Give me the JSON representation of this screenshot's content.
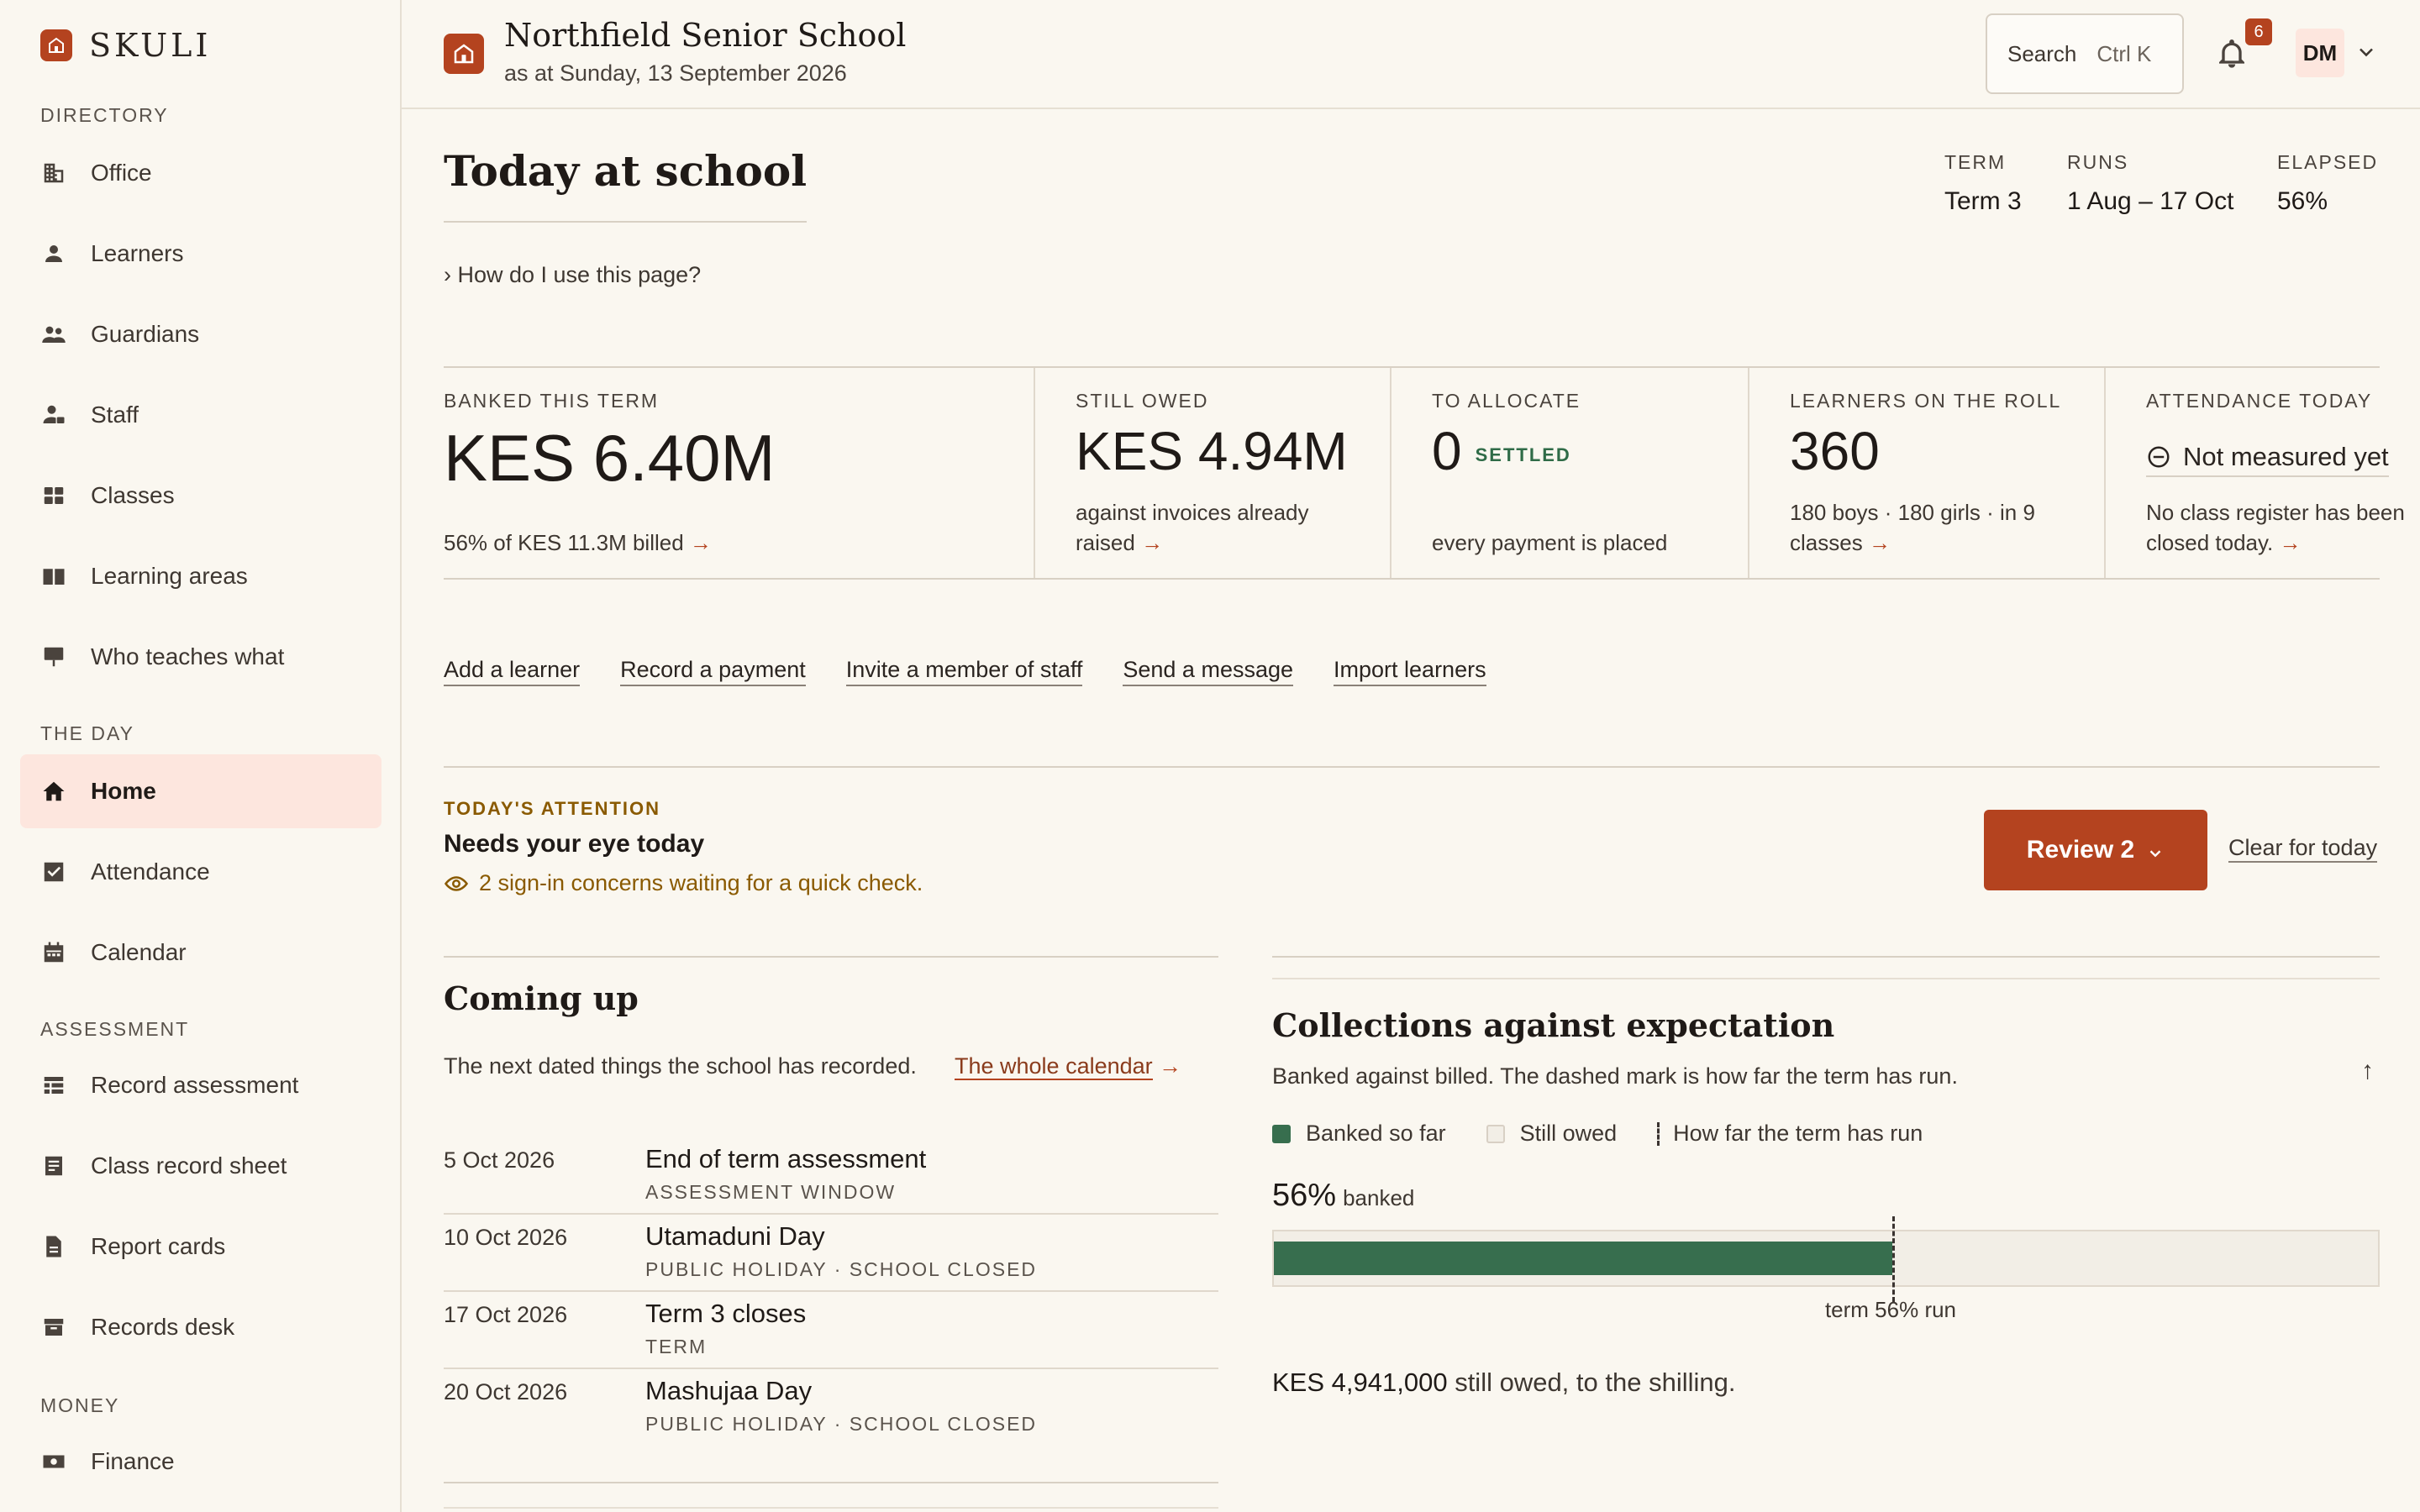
{
  "brand": {
    "name": "SKULI"
  },
  "sidebar": {
    "sections": [
      {
        "title": "Directory",
        "items": [
          "Office",
          "Learners",
          "Guardians",
          "Staff",
          "Classes",
          "Learning areas",
          "Who teaches what"
        ]
      },
      {
        "title": "The day",
        "items": [
          "Home",
          "Attendance",
          "Calendar"
        ]
      },
      {
        "title": "Assessment",
        "items": [
          "Record assessment",
          "Class record sheet",
          "Report cards",
          "Records desk"
        ]
      },
      {
        "title": "Money",
        "items": [
          "Finance"
        ]
      }
    ],
    "active": "Home"
  },
  "header": {
    "school_name": "Northfield Senior School",
    "as_at": "as at Sunday, 13 September 2026",
    "search_label": "Search",
    "search_shortcut": "Ctrl K",
    "notifications": "6",
    "avatar_initials": "DM"
  },
  "page": {
    "title": "Today at school",
    "help": "› How do I use this page?",
    "term": {
      "term_label": "Term",
      "term_value": "Term 3",
      "runs_label": "Runs",
      "runs_value": "1 Aug – 17 Oct",
      "elapsed_label": "Elapsed",
      "elapsed_value": "56%"
    }
  },
  "stats": {
    "banked": {
      "label": "Banked this term",
      "value": "KES 6.40M",
      "sub": "56% of KES 11.3M billed"
    },
    "owed": {
      "label": "Still owed",
      "value": "KES 4.94M",
      "sub1": "against invoices already",
      "sub2": "raised"
    },
    "allocate": {
      "label": "To allocate",
      "value": "0",
      "badge": "SETTLED",
      "sub": "every payment is placed"
    },
    "roll": {
      "label": "Learners on the roll",
      "value": "360",
      "sub1": "180 boys · 180 girls · in 9",
      "sub2": "classes"
    },
    "attendance": {
      "label": "Attendance today",
      "value": "Not measured yet",
      "sub1": "No class register has been",
      "sub2": "closed today."
    }
  },
  "quick_actions": [
    "Add a learner",
    "Record a payment",
    "Invite a member of staff",
    "Send a message",
    "Import learners"
  ],
  "attention": {
    "eyebrow": "TODAY'S ATTENTION",
    "title": "Needs your eye today",
    "note": "2 sign-in concerns waiting for a quick check.",
    "review_label": "Review 2",
    "clear_label": "Clear for today"
  },
  "coming_up": {
    "title": "Coming up",
    "description": "The next dated things the school has recorded.",
    "link": "The whole calendar",
    "events": [
      {
        "date": "5 Oct 2026",
        "name": "End of term assessment",
        "kind": "Assessment window"
      },
      {
        "date": "10 Oct 2026",
        "name": "Utamaduni Day",
        "kind": "Public holiday · School closed"
      },
      {
        "date": "17 Oct 2026",
        "name": "Term 3 closes",
        "kind": "Term"
      },
      {
        "date": "20 Oct 2026",
        "name": "Mashujaa Day",
        "kind": "Public holiday · School closed"
      }
    ]
  },
  "collections": {
    "title": "Collections against expectation",
    "description": "Banked against billed. The dashed mark is how far the term has run.",
    "legend": [
      "Banked so far",
      "Still owed",
      "How far the term has run"
    ],
    "banked_pct_label": "56%",
    "banked_word": "banked",
    "banked_fraction": 0.56,
    "term_run_fraction": 0.56,
    "term_caption": "term 56% run",
    "owed_amount": "KES 4,941,000",
    "owed_suffix": "still owed, to the shilling.",
    "colors": {
      "banked": "#376e4e",
      "owed": "#f2eee6",
      "accent": "#b4431f"
    }
  }
}
